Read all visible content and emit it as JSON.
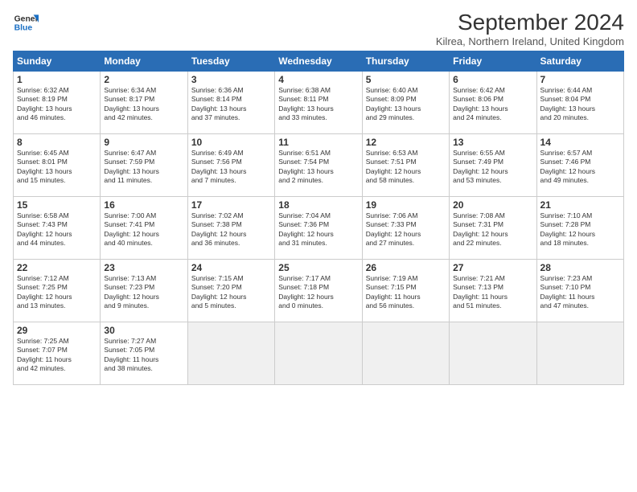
{
  "logo": {
    "line1": "General",
    "line2": "Blue"
  },
  "title": "September 2024",
  "subtitle": "Kilrea, Northern Ireland, United Kingdom",
  "weekdays": [
    "Sunday",
    "Monday",
    "Tuesday",
    "Wednesday",
    "Thursday",
    "Friday",
    "Saturday"
  ],
  "weeks": [
    [
      {
        "day": "1",
        "detail": "Sunrise: 6:32 AM\nSunset: 8:19 PM\nDaylight: 13 hours\nand 46 minutes."
      },
      {
        "day": "2",
        "detail": "Sunrise: 6:34 AM\nSunset: 8:17 PM\nDaylight: 13 hours\nand 42 minutes."
      },
      {
        "day": "3",
        "detail": "Sunrise: 6:36 AM\nSunset: 8:14 PM\nDaylight: 13 hours\nand 37 minutes."
      },
      {
        "day": "4",
        "detail": "Sunrise: 6:38 AM\nSunset: 8:11 PM\nDaylight: 13 hours\nand 33 minutes."
      },
      {
        "day": "5",
        "detail": "Sunrise: 6:40 AM\nSunset: 8:09 PM\nDaylight: 13 hours\nand 29 minutes."
      },
      {
        "day": "6",
        "detail": "Sunrise: 6:42 AM\nSunset: 8:06 PM\nDaylight: 13 hours\nand 24 minutes."
      },
      {
        "day": "7",
        "detail": "Sunrise: 6:44 AM\nSunset: 8:04 PM\nDaylight: 13 hours\nand 20 minutes."
      }
    ],
    [
      {
        "day": "8",
        "detail": "Sunrise: 6:45 AM\nSunset: 8:01 PM\nDaylight: 13 hours\nand 15 minutes."
      },
      {
        "day": "9",
        "detail": "Sunrise: 6:47 AM\nSunset: 7:59 PM\nDaylight: 13 hours\nand 11 minutes."
      },
      {
        "day": "10",
        "detail": "Sunrise: 6:49 AM\nSunset: 7:56 PM\nDaylight: 13 hours\nand 7 minutes."
      },
      {
        "day": "11",
        "detail": "Sunrise: 6:51 AM\nSunset: 7:54 PM\nDaylight: 13 hours\nand 2 minutes."
      },
      {
        "day": "12",
        "detail": "Sunrise: 6:53 AM\nSunset: 7:51 PM\nDaylight: 12 hours\nand 58 minutes."
      },
      {
        "day": "13",
        "detail": "Sunrise: 6:55 AM\nSunset: 7:49 PM\nDaylight: 12 hours\nand 53 minutes."
      },
      {
        "day": "14",
        "detail": "Sunrise: 6:57 AM\nSunset: 7:46 PM\nDaylight: 12 hours\nand 49 minutes."
      }
    ],
    [
      {
        "day": "15",
        "detail": "Sunrise: 6:58 AM\nSunset: 7:43 PM\nDaylight: 12 hours\nand 44 minutes."
      },
      {
        "day": "16",
        "detail": "Sunrise: 7:00 AM\nSunset: 7:41 PM\nDaylight: 12 hours\nand 40 minutes."
      },
      {
        "day": "17",
        "detail": "Sunrise: 7:02 AM\nSunset: 7:38 PM\nDaylight: 12 hours\nand 36 minutes."
      },
      {
        "day": "18",
        "detail": "Sunrise: 7:04 AM\nSunset: 7:36 PM\nDaylight: 12 hours\nand 31 minutes."
      },
      {
        "day": "19",
        "detail": "Sunrise: 7:06 AM\nSunset: 7:33 PM\nDaylight: 12 hours\nand 27 minutes."
      },
      {
        "day": "20",
        "detail": "Sunrise: 7:08 AM\nSunset: 7:31 PM\nDaylight: 12 hours\nand 22 minutes."
      },
      {
        "day": "21",
        "detail": "Sunrise: 7:10 AM\nSunset: 7:28 PM\nDaylight: 12 hours\nand 18 minutes."
      }
    ],
    [
      {
        "day": "22",
        "detail": "Sunrise: 7:12 AM\nSunset: 7:25 PM\nDaylight: 12 hours\nand 13 minutes."
      },
      {
        "day": "23",
        "detail": "Sunrise: 7:13 AM\nSunset: 7:23 PM\nDaylight: 12 hours\nand 9 minutes."
      },
      {
        "day": "24",
        "detail": "Sunrise: 7:15 AM\nSunset: 7:20 PM\nDaylight: 12 hours\nand 5 minutes."
      },
      {
        "day": "25",
        "detail": "Sunrise: 7:17 AM\nSunset: 7:18 PM\nDaylight: 12 hours\nand 0 minutes."
      },
      {
        "day": "26",
        "detail": "Sunrise: 7:19 AM\nSunset: 7:15 PM\nDaylight: 11 hours\nand 56 minutes."
      },
      {
        "day": "27",
        "detail": "Sunrise: 7:21 AM\nSunset: 7:13 PM\nDaylight: 11 hours\nand 51 minutes."
      },
      {
        "day": "28",
        "detail": "Sunrise: 7:23 AM\nSunset: 7:10 PM\nDaylight: 11 hours\nand 47 minutes."
      }
    ],
    [
      {
        "day": "29",
        "detail": "Sunrise: 7:25 AM\nSunset: 7:07 PM\nDaylight: 11 hours\nand 42 minutes."
      },
      {
        "day": "30",
        "detail": "Sunrise: 7:27 AM\nSunset: 7:05 PM\nDaylight: 11 hours\nand 38 minutes."
      },
      {
        "day": "",
        "detail": "",
        "empty": true
      },
      {
        "day": "",
        "detail": "",
        "empty": true
      },
      {
        "day": "",
        "detail": "",
        "empty": true
      },
      {
        "day": "",
        "detail": "",
        "empty": true
      },
      {
        "day": "",
        "detail": "",
        "empty": true
      }
    ]
  ]
}
